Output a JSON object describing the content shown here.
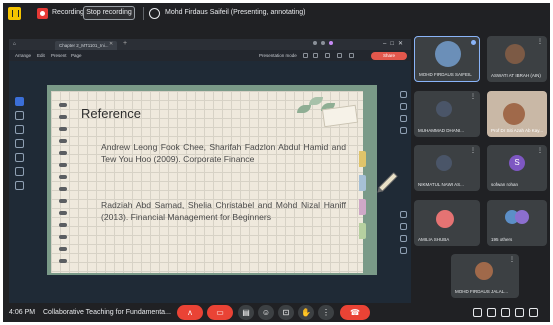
{
  "colors": {
    "accent_red": "#ea4335",
    "panel_dark": "#202124"
  },
  "top_bar": {
    "recording_label": "Recording",
    "stop_button": "Stop recording",
    "presenter_label": "Mohd Firdaus Saifeil (Presenting, annotating)"
  },
  "shared_window": {
    "tab_title": "Chapter 2_MT1101_Ini...",
    "menu": [
      "Arrange",
      "Edit",
      "Present",
      "Page"
    ],
    "zoom_label": "Presentation mode",
    "share_button": "Share"
  },
  "slide": {
    "title": "Reference",
    "references": [
      "Andrew Leong Fook Chee, Sharifah Fadzlon Abdul Hamid and Tew You Hoo (2009). Corporate Finance",
      "Radziah Abd Samad, Shelia Christabel and Mohd Nizal Haniff (2013). Financial Management for Beginners"
    ]
  },
  "participants": [
    {
      "name": "MOHD FIRDAUS SAIFEIL",
      "avatar_color": "#6b8fb8",
      "presenting": true
    },
    {
      "name": "ASWATI AT IBRAH (AIN)",
      "avatar_color": "#7c5a45"
    },
    {
      "name": "MUHAMMAD DHANI...",
      "avatar_color": "#4a5568"
    },
    {
      "name": "Prof Dr Siti Azah Ab Kay...",
      "avatar_color": "#a0694a"
    },
    {
      "name": "NIKMATUL NAWI AS...",
      "avatar_color": "#4a5568"
    },
    {
      "name": "sofwan rohan",
      "initial": "S",
      "avatar_color": "#7e57c2"
    },
    {
      "name": "AMILIA SHUBA",
      "avatar_color": "#e57373"
    },
    {
      "name": "NN",
      "label": "195 others",
      "avatar_color": "#5c8fc7"
    },
    {
      "name": "MOHD FIRDAUS JALAL...",
      "avatar_color": "#a0694a"
    }
  ],
  "bottom_bar": {
    "time": "4:06 PM",
    "meeting_title": "Collaborative Teaching for Fundamenta..."
  }
}
